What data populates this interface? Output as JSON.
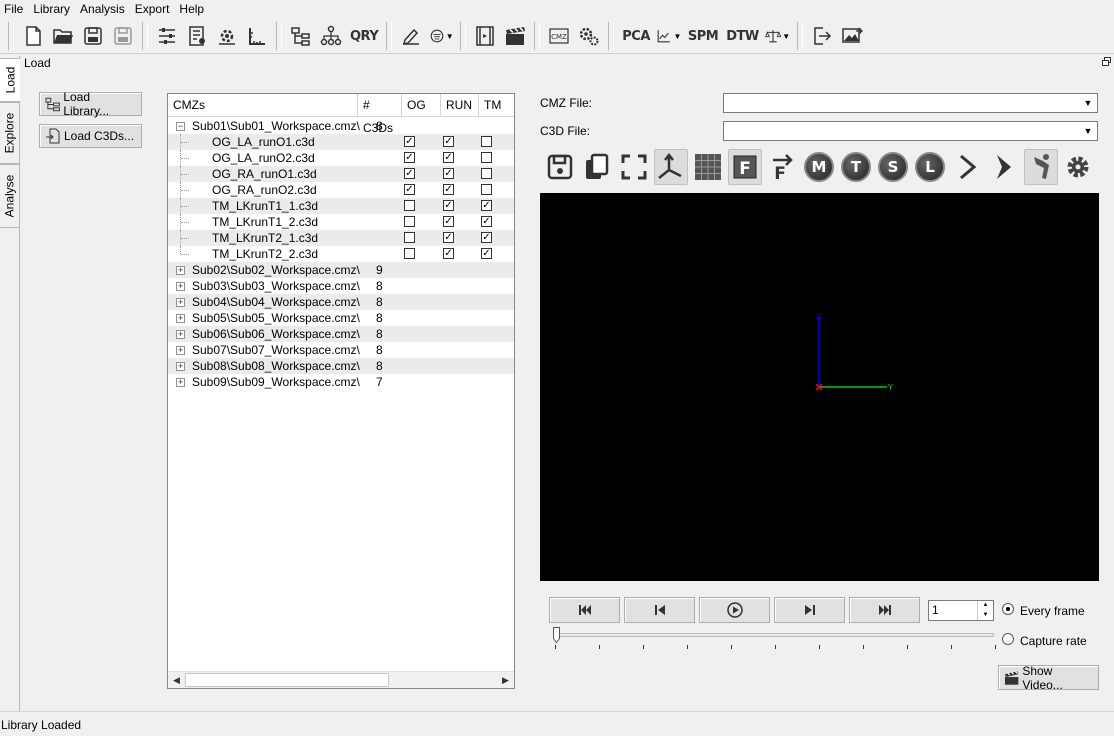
{
  "menu": [
    "File",
    "Library",
    "Analysis",
    "Export",
    "Help"
  ],
  "toolbar": {
    "qry_label": "QRY",
    "pca_label": "PCA",
    "spm_label": "SPM",
    "dtw_label": "DTW"
  },
  "tabs": [
    "Load",
    "Explore",
    "Analyse"
  ],
  "panel_title": "Load",
  "buttons": {
    "load_library": "Load Library...",
    "load_c3ds": "Load C3Ds...",
    "show_video": "Show Video..."
  },
  "tree": {
    "columns": [
      "CMZs",
      "# C3Ds",
      "OG",
      "RUN",
      "TM"
    ],
    "root": {
      "name": "Sub01\\Sub01_Workspace.cmz\\",
      "count": "8",
      "children": [
        {
          "name": "OG_LA_runO1.c3d",
          "og": true,
          "run": true,
          "tm": false
        },
        {
          "name": "OG_LA_runO2.c3d",
          "og": true,
          "run": true,
          "tm": false
        },
        {
          "name": "OG_RA_runO1.c3d",
          "og": true,
          "run": true,
          "tm": false
        },
        {
          "name": "OG_RA_runO2.c3d",
          "og": true,
          "run": true,
          "tm": false
        },
        {
          "name": "TM_LKrunT1_1.c3d",
          "og": false,
          "run": true,
          "tm": true
        },
        {
          "name": "TM_LKrunT1_2.c3d",
          "og": false,
          "run": true,
          "tm": true
        },
        {
          "name": "TM_LKrunT2_1.c3d",
          "og": false,
          "run": true,
          "tm": true
        },
        {
          "name": "TM_LKrunT2_2.c3d",
          "og": false,
          "run": true,
          "tm": true
        }
      ]
    },
    "others": [
      {
        "name": "Sub02\\Sub02_Workspace.cmz\\",
        "count": "9"
      },
      {
        "name": "Sub03\\Sub03_Workspace.cmz\\",
        "count": "8"
      },
      {
        "name": "Sub04\\Sub04_Workspace.cmz\\",
        "count": "8"
      },
      {
        "name": "Sub05\\Sub05_Workspace.cmz\\",
        "count": "8"
      },
      {
        "name": "Sub06\\Sub06_Workspace.cmz\\",
        "count": "8"
      },
      {
        "name": "Sub07\\Sub07_Workspace.cmz\\",
        "count": "8"
      },
      {
        "name": "Sub08\\Sub08_Workspace.cmz\\",
        "count": "8"
      },
      {
        "name": "Sub09\\Sub09_Workspace.cmz\\",
        "count": "7"
      }
    ]
  },
  "file_labels": {
    "cmz": "CMZ File:",
    "c3d": "C3D File:"
  },
  "view_letters": [
    "M",
    "T",
    "S",
    "L"
  ],
  "axes": {
    "z": "Z",
    "y": "Y"
  },
  "playback": {
    "frame_value": "1",
    "every_frame": "Every frame",
    "capture_rate": "Capture rate",
    "selected": "every_frame"
  },
  "status": "Library Loaded",
  "colors": {
    "viewport_bg": "#000000",
    "axis_z": "#0000ff",
    "axis_y": "#00cc00",
    "origin": "#ff0000"
  }
}
